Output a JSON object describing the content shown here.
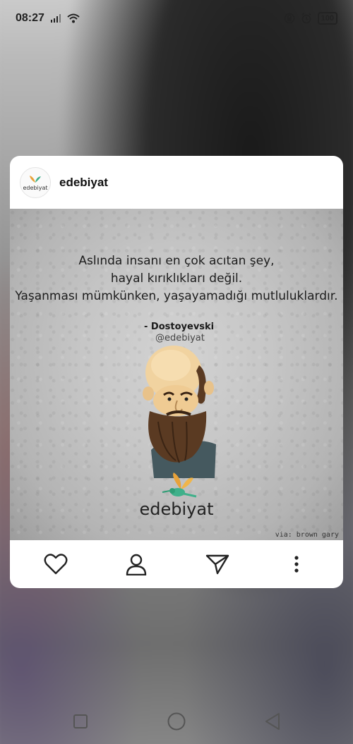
{
  "status_bar": {
    "time": "08:27",
    "battery": "100"
  },
  "post": {
    "account_name": "edebiyat",
    "avatar_text": "edebiyat",
    "quote_lines": [
      "Aslında insanı en çok acıtan şey,",
      "hayal kırıklıkları değil.",
      "Yaşanması mümkünken, yaşayamadığı mutluluklardır."
    ],
    "author": "- Dostoyevski",
    "handle": "@edebiyat",
    "brand": "edebiyat",
    "credit": "via: brown gary"
  },
  "actions": {
    "like": "heart-icon",
    "profile": "person-icon",
    "share": "send-icon",
    "more": "more-vertical-icon"
  },
  "colors": {
    "accent_green": "#3fb08a",
    "accent_orange": "#e8a23a"
  }
}
